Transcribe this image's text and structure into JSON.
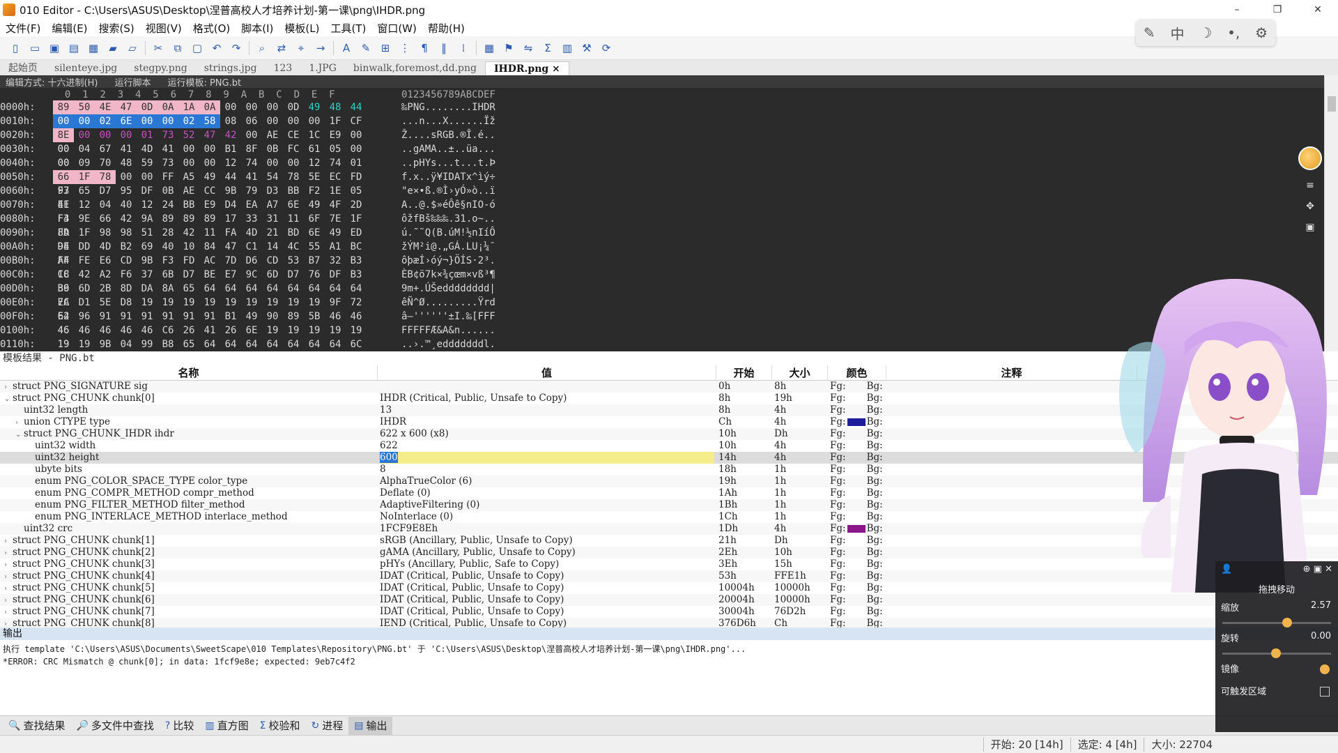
{
  "window": {
    "title": "010 Editor - C:\\Users\\ASUS\\Desktop\\涅普高校人才培养计划-第一课\\png\\IHDR.png",
    "controls": [
      "–",
      "❐",
      "✕"
    ]
  },
  "menu": [
    "文件(F)",
    "编辑(E)",
    "搜索(S)",
    "视图(V)",
    "格式(O)",
    "脚本(I)",
    "模板(L)",
    "工具(T)",
    "窗口(W)",
    "帮助(H)"
  ],
  "ime": {
    "items": [
      "✎",
      "中",
      "☽",
      "•,",
      "⚙"
    ]
  },
  "tabs": [
    {
      "label": "起始页"
    },
    {
      "label": "silenteye.jpg"
    },
    {
      "label": "stegpy.png"
    },
    {
      "label": "strings.jpg"
    },
    {
      "label": "123"
    },
    {
      "label": "1.JPG"
    },
    {
      "label": "binwalk,foremost,dd.png"
    },
    {
      "label": "IHDR.png",
      "active": true,
      "close": "×"
    }
  ],
  "hexbar": {
    "edit_mode": "编辑方式: 十六进制(H)",
    "run_script": "运行脚本",
    "run_template": "运行模板: PNG.bt"
  },
  "hex": {
    "col_header": "  0  1  2  3  4  5  6  7  8  9  A  B  C  D  E  F",
    "ascii_header": "0123456789ABCDEF",
    "rows": [
      {
        "addr": "0000h:",
        "bytes": [
          "89",
          "50",
          "4E",
          "47",
          "0D",
          "0A",
          "1A",
          "0A",
          "00",
          "00",
          "00",
          "0D",
          "49",
          "48",
          "44",
          "52"
        ],
        "ascii": "‰PNG........IHDR"
      },
      {
        "addr": "0010h:",
        "bytes": [
          "00",
          "00",
          "02",
          "6E",
          "00",
          "00",
          "02",
          "58",
          "08",
          "06",
          "00",
          "00",
          "00",
          "1F",
          "CF",
          "9E"
        ],
        "ascii": "...n...X......Ïž"
      },
      {
        "addr": "0020h:",
        "bytes": [
          "8E",
          "00",
          "00",
          "00",
          "01",
          "73",
          "52",
          "47",
          "42",
          "00",
          "AE",
          "CE",
          "1C",
          "E9",
          "00",
          "00"
        ],
        "ascii": "Ž....sRGB.®Î.é.."
      },
      {
        "addr": "0030h:",
        "bytes": [
          "00",
          "04",
          "67",
          "41",
          "4D",
          "41",
          "00",
          "00",
          "B1",
          "8F",
          "0B",
          "FC",
          "61",
          "05",
          "00",
          "00"
        ],
        "ascii": "..gAMA..±..üa..."
      },
      {
        "addr": "0040h:",
        "bytes": [
          "00",
          "09",
          "70",
          "48",
          "59",
          "73",
          "00",
          "00",
          "12",
          "74",
          "00",
          "00",
          "12",
          "74",
          "01",
          "DE"
        ],
        "ascii": "..pHYs...t...t.Þ"
      },
      {
        "addr": "0050h:",
        "bytes": [
          "66",
          "1F",
          "78",
          "00",
          "00",
          "FF",
          "A5",
          "49",
          "44",
          "41",
          "54",
          "78",
          "5E",
          "EC",
          "FD",
          "F7"
        ],
        "ascii": "f.x..ÿ¥IDATx^ìý÷"
      },
      {
        "addr": "0060h:",
        "bytes": [
          "93",
          "65",
          "D7",
          "95",
          "DF",
          "0B",
          "AE",
          "CC",
          "9B",
          "79",
          "D3",
          "BB",
          "F2",
          "1E",
          "05",
          "EF"
        ],
        "ascii": "\"e×•ß.®Ì›yÓ»ò..ï"
      },
      {
        "addr": "0070h:",
        "bytes": [
          "41",
          "12",
          "04",
          "40",
          "12",
          "24",
          "BB",
          "E9",
          "D4",
          "EA",
          "A7",
          "6E",
          "49",
          "4F",
          "2D",
          "F3"
        ],
        "ascii": "A..@.$»éÔê§nIO-ó"
      },
      {
        "addr": "0080h:",
        "bytes": [
          "F4",
          "9E",
          "66",
          "42",
          "9A",
          "89",
          "89",
          "89",
          "17",
          "33",
          "31",
          "11",
          "6F",
          "7E",
          "1F",
          "8D"
        ],
        "ascii": "ôžfBš‰‰‰.31.o~.."
      },
      {
        "addr": "0090h:",
        "bytes": [
          "FA",
          "1F",
          "98",
          "98",
          "51",
          "28",
          "42",
          "11",
          "FA",
          "4D",
          "21",
          "BD",
          "6E",
          "49",
          "ED",
          "D4"
        ],
        "ascii": "ú.˜˜Q(B.úM!½nIíÔ"
      },
      {
        "addr": "00A0h:",
        "bytes": [
          "9E",
          "DD",
          "4D",
          "B2",
          "69",
          "40",
          "10",
          "84",
          "47",
          "C1",
          "14",
          "4C",
          "55",
          "A1",
          "BC",
          "AF"
        ],
        "ascii": "žÝM²i@.„GÁ.LU¡¼¯"
      },
      {
        "addr": "00B0h:",
        "bytes": [
          "F4",
          "FE",
          "E6",
          "CD",
          "9B",
          "F3",
          "FD",
          "AC",
          "7D",
          "D6",
          "CD",
          "53",
          "B7",
          "32",
          "B3",
          "1C"
        ],
        "ascii": "ôþæÍ›óý¬}ÖÍS·2³."
      },
      {
        "addr": "00C0h:",
        "bytes": [
          "C8",
          "42",
          "A2",
          "F6",
          "37",
          "6B",
          "D7",
          "BE",
          "E7",
          "9C",
          "6D",
          "D7",
          "76",
          "DF",
          "B3",
          "B6"
        ],
        "ascii": "ÈB¢ö7k×¾çœm×vß³¶"
      },
      {
        "addr": "00D0h:",
        "bytes": [
          "39",
          "6D",
          "2B",
          "8D",
          "DA",
          "8A",
          "65",
          "64",
          "64",
          "64",
          "64",
          "64",
          "64",
          "64",
          "64",
          "7C"
        ],
        "ascii": "9m+.ÚŠedddddddd|"
      },
      {
        "addr": "00E0h:",
        "bytes": [
          "EA",
          "D1",
          "5E",
          "D8",
          "19",
          "19",
          "19",
          "19",
          "19",
          "19",
          "19",
          "19",
          "19",
          "9F",
          "72",
          "64"
        ],
        "ascii": "êÑ^Ø.........Ÿrd"
      },
      {
        "addr": "00F0h:",
        "bytes": [
          "E2",
          "96",
          "91",
          "91",
          "91",
          "91",
          "91",
          "91",
          "B1",
          "49",
          "90",
          "89",
          "5B",
          "46",
          "46",
          "46"
        ],
        "ascii": "â–''''''±I.‰[FFF"
      },
      {
        "addr": "0100h:",
        "bytes": [
          "46",
          "46",
          "46",
          "46",
          "46",
          "C6",
          "26",
          "41",
          "26",
          "6E",
          "19",
          "19",
          "19",
          "19",
          "19",
          "19"
        ],
        "ascii": "FFFFFÆ&A&n......"
      },
      {
        "addr": "0110h:",
        "bytes": [
          "19",
          "19",
          "9B",
          "04",
          "99",
          "B8",
          "65",
          "64",
          "64",
          "64",
          "64",
          "64",
          "64",
          "64",
          "6C",
          "12"
        ],
        "ascii": "..›.™¸edddddddl."
      }
    ]
  },
  "template": {
    "header": "模板结果 - PNG.bt",
    "columns": [
      "名称",
      "值",
      "开始",
      "大小",
      "颜色",
      "注释"
    ],
    "rows": [
      {
        "name": "struct PNG_SIGNATURE sig",
        "indent": 0,
        "tw": "›",
        "value": "",
        "start": "0h",
        "size": "8h",
        "fg": "Fg:",
        "bg": "Bg:",
        "swatch": ""
      },
      {
        "name": "struct PNG_CHUNK chunk[0]",
        "indent": 0,
        "tw": "⌄",
        "value": "IHDR  (Critical, Public, Unsafe to Copy)",
        "start": "8h",
        "size": "19h",
        "fg": "Fg:",
        "bg": "Bg:",
        "swatch": ""
      },
      {
        "name": "uint32 length",
        "indent": 1,
        "tw": "",
        "value": "13",
        "start": "8h",
        "size": "4h",
        "fg": "Fg:",
        "bg": "Bg:",
        "swatch": ""
      },
      {
        "name": "union CTYPE type",
        "indent": 1,
        "tw": "›",
        "value": "IHDR",
        "start": "Ch",
        "size": "4h",
        "fg": "Fg:",
        "bg": "Bg:",
        "swatch": "#1e1e9a"
      },
      {
        "name": "struct PNG_CHUNK_IHDR ihdr",
        "indent": 1,
        "tw": "⌄",
        "value": "622 x 600 (x8)",
        "start": "10h",
        "size": "Dh",
        "fg": "Fg:",
        "bg": "Bg:",
        "swatch": ""
      },
      {
        "name": "uint32 width",
        "indent": 2,
        "tw": "",
        "value": "622",
        "start": "10h",
        "size": "4h",
        "fg": "Fg:",
        "bg": "Bg:",
        "swatch": ""
      },
      {
        "name": "uint32 height",
        "indent": 2,
        "tw": "",
        "value": "600",
        "start": "14h",
        "size": "4h",
        "fg": "Fg:",
        "bg": "Bg:",
        "swatch": "",
        "selected": true
      },
      {
        "name": "ubyte bits",
        "indent": 2,
        "tw": "",
        "value": "8",
        "start": "18h",
        "size": "1h",
        "fg": "Fg:",
        "bg": "Bg:",
        "swatch": ""
      },
      {
        "name": "enum PNG_COLOR_SPACE_TYPE color_type",
        "indent": 2,
        "tw": "",
        "value": "AlphaTrueColor (6)",
        "start": "19h",
        "size": "1h",
        "fg": "Fg:",
        "bg": "Bg:",
        "swatch": ""
      },
      {
        "name": "enum PNG_COMPR_METHOD compr_method",
        "indent": 2,
        "tw": "",
        "value": "Deflate (0)",
        "start": "1Ah",
        "size": "1h",
        "fg": "Fg:",
        "bg": "Bg:",
        "swatch": ""
      },
      {
        "name": "enum PNG_FILTER_METHOD filter_method",
        "indent": 2,
        "tw": "",
        "value": "AdaptiveFiltering (0)",
        "start": "1Bh",
        "size": "1h",
        "fg": "Fg:",
        "bg": "Bg:",
        "swatch": ""
      },
      {
        "name": "enum PNG_INTERLACE_METHOD interlace_method",
        "indent": 2,
        "tw": "",
        "value": "NoInterlace (0)",
        "start": "1Ch",
        "size": "1h",
        "fg": "Fg:",
        "bg": "Bg:",
        "swatch": ""
      },
      {
        "name": "uint32 crc",
        "indent": 1,
        "tw": "",
        "value": "1FCF9E8Eh",
        "start": "1Dh",
        "size": "4h",
        "fg": "Fg:",
        "bg": "Bg:",
        "swatch": "#8a168a"
      },
      {
        "name": "struct PNG_CHUNK chunk[1]",
        "indent": 0,
        "tw": "›",
        "value": "sRGB  (Ancillary, Public, Unsafe to Copy)",
        "start": "21h",
        "size": "Dh",
        "fg": "Fg:",
        "bg": "Bg:",
        "swatch": ""
      },
      {
        "name": "struct PNG_CHUNK chunk[2]",
        "indent": 0,
        "tw": "›",
        "value": "gAMA  (Ancillary, Public, Unsafe to Copy)",
        "start": "2Eh",
        "size": "10h",
        "fg": "Fg:",
        "bg": "Bg:",
        "swatch": ""
      },
      {
        "name": "struct PNG_CHUNK chunk[3]",
        "indent": 0,
        "tw": "›",
        "value": "pHYs  (Ancillary, Public, Safe to Copy)",
        "start": "3Eh",
        "size": "15h",
        "fg": "Fg:",
        "bg": "Bg:",
        "swatch": ""
      },
      {
        "name": "struct PNG_CHUNK chunk[4]",
        "indent": 0,
        "tw": "›",
        "value": "IDAT  (Critical, Public, Unsafe to Copy)",
        "start": "53h",
        "size": "FFE1h",
        "fg": "Fg:",
        "bg": "Bg:",
        "swatch": ""
      },
      {
        "name": "struct PNG_CHUNK chunk[5]",
        "indent": 0,
        "tw": "›",
        "value": "IDAT  (Critical, Public, Unsafe to Copy)",
        "start": "10004h",
        "size": "10000h",
        "fg": "Fg:",
        "bg": "Bg:",
        "swatch": ""
      },
      {
        "name": "struct PNG_CHUNK chunk[6]",
        "indent": 0,
        "tw": "›",
        "value": "IDAT  (Critical, Public, Unsafe to Copy)",
        "start": "20004h",
        "size": "10000h",
        "fg": "Fg:",
        "bg": "Bg:",
        "swatch": ""
      },
      {
        "name": "struct PNG_CHUNK chunk[7]",
        "indent": 0,
        "tw": "›",
        "value": "IDAT  (Critical, Public, Unsafe to Copy)",
        "start": "30004h",
        "size": "76D2h",
        "fg": "Fg:",
        "bg": "Bg:",
        "swatch": ""
      },
      {
        "name": "struct PNG_CHUNK chunk[8]",
        "indent": 0,
        "tw": "›",
        "value": "IEND  (Critical, Public, Unsafe to Copy)",
        "start": "376D6h",
        "size": "Ch",
        "fg": "Fg:",
        "bg": "Bg:",
        "swatch": ""
      }
    ]
  },
  "output": {
    "header": "输出",
    "lines": [
      "执行 template 'C:\\Users\\ASUS\\Documents\\SweetScape\\010 Templates\\Repository\\PNG.bt' 于 'C:\\Users\\ASUS\\Desktop\\涅普高校人才培养计划-第一课\\png\\IHDR.png'...",
      "*ERROR: CRC Mismatch @ chunk[0]; in data: 1fcf9e8e; expected: 9eb7c4f2"
    ]
  },
  "bottom_tabs": [
    {
      "icon": "🔍",
      "label": "查找结果"
    },
    {
      "icon": "🔎",
      "label": "多文件中查找"
    },
    {
      "icon": "?",
      "label": "比较"
    },
    {
      "icon": "▥",
      "label": "直方图"
    },
    {
      "icon": "Σ",
      "label": "校验和"
    },
    {
      "icon": "↻",
      "label": "进程"
    },
    {
      "icon": "▤",
      "label": "输出",
      "active": true
    }
  ],
  "status": {
    "start": "开始: 20 [14h]",
    "selected": "选定: 4 [4h]",
    "size": "大小: 22704"
  },
  "avatar_panel": {
    "title": "拖拽移动",
    "scale_label": "缩放",
    "scale_value": "2.57",
    "scale_level": 0.55,
    "rotate_label": "旋转",
    "rotate_value": "0.00",
    "rotate_level": 0.45,
    "mirror_label": "镜像",
    "touch_label": "可触发区域"
  },
  "colors": {
    "hex_bg": "#2b2b2b",
    "selection_blue": "#2a78d4",
    "value_highlight": "#f5ec8a"
  }
}
